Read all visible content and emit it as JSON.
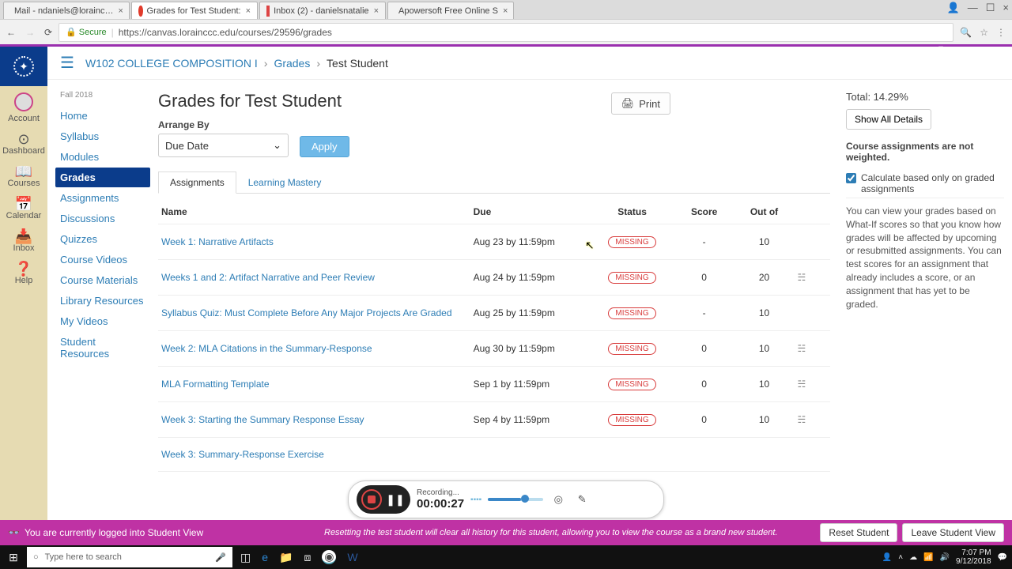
{
  "chrome": {
    "tabs": [
      {
        "label": "Mail - ndaniels@lorainc…"
      },
      {
        "label": "Grades for Test Student:"
      },
      {
        "label": "Inbox (2) - danielsnatalie"
      },
      {
        "label": "Apowersoft Free Online S"
      }
    ],
    "secure_label": "Secure",
    "url": "https://canvas.lorainccc.edu/courses/29596/grades",
    "watermark": "Apowersoft"
  },
  "breadcrumbs": {
    "course": "W102 COLLEGE COMPOSITION I",
    "grades": "Grades",
    "current": "Test Student"
  },
  "globalnav": {
    "account": "Account",
    "dashboard": "Dashboard",
    "courses": "Courses",
    "calendar": "Calendar",
    "inbox": "Inbox",
    "help": "Help"
  },
  "coursenav": {
    "term": "Fall 2018",
    "items": [
      "Home",
      "Syllabus",
      "Modules",
      "Grades",
      "Assignments",
      "Discussions",
      "Quizzes",
      "Course Videos",
      "Course Materials",
      "Library Resources",
      "My Videos",
      "Student Resources"
    ],
    "active_index": 3
  },
  "grades": {
    "title": "Grades for Test Student",
    "arrange_by_label": "Arrange By",
    "arrange_value": "Due Date",
    "apply_label": "Apply",
    "print_label": "Print",
    "tabs": {
      "assignments": "Assignments",
      "learning_mastery": "Learning Mastery"
    },
    "headers": {
      "name": "Name",
      "due": "Due",
      "status": "Status",
      "score": "Score",
      "outof": "Out of"
    },
    "missing_label": "MISSING",
    "rows": [
      {
        "name": "Week 1: Narrative Artifacts",
        "due": "Aug 23 by 11:59pm",
        "status": "MISSING",
        "score": "-",
        "outof": "10",
        "detail": false
      },
      {
        "name": "Weeks 1 and 2: Artifact Narrative and Peer Review",
        "due": "Aug 24 by 11:59pm",
        "status": "MISSING",
        "score": "0",
        "outof": "20",
        "detail": true
      },
      {
        "name": "Syllabus Quiz: Must Complete Before Any Major Projects Are Graded",
        "due": "Aug 25 by 11:59pm",
        "status": "MISSING",
        "score": "-",
        "outof": "10",
        "detail": false
      },
      {
        "name": "Week 2: MLA Citations in the Summary-Response",
        "due": "Aug 30 by 11:59pm",
        "status": "MISSING",
        "score": "0",
        "outof": "10",
        "detail": true
      },
      {
        "name": "MLA Formatting Template",
        "due": "Sep 1 by 11:59pm",
        "status": "MISSING",
        "score": "0",
        "outof": "10",
        "detail": true
      },
      {
        "name": "Week 3: Starting the Summary Response Essay",
        "due": "Sep 4 by 11:59pm",
        "status": "MISSING",
        "score": "0",
        "outof": "10",
        "detail": true
      },
      {
        "name": "Week 3: Summary-Response Exercise",
        "due": "",
        "status": "",
        "score": "",
        "outof": "",
        "detail": false
      }
    ]
  },
  "sidebar": {
    "total_label": "Total: 14.29%",
    "show_all": "Show All Details",
    "weight_note": "Course assignments are not weighted.",
    "calc_label": "Calculate based only on graded assignments",
    "whatif_note": "You can view your grades based on What-If scores so that you know how grades will be affected by upcoming or resubmitted assignments. You can test scores for an assignment that already includes a score, or an assignment that has yet to be graded."
  },
  "studentview": {
    "glasses": "👓",
    "msg": "You are currently logged into Student View",
    "reset_msg": "Resetting the test student will clear all history for this student, allowing you to view the course as a brand new student.",
    "reset_btn": "Reset Student",
    "leave_btn": "Leave Student View"
  },
  "recorder": {
    "status": "Recording...",
    "time": "00:00:27"
  },
  "taskbar": {
    "search_placeholder": "Type here to search",
    "time": "7:07 PM",
    "date": "9/12/2018"
  }
}
